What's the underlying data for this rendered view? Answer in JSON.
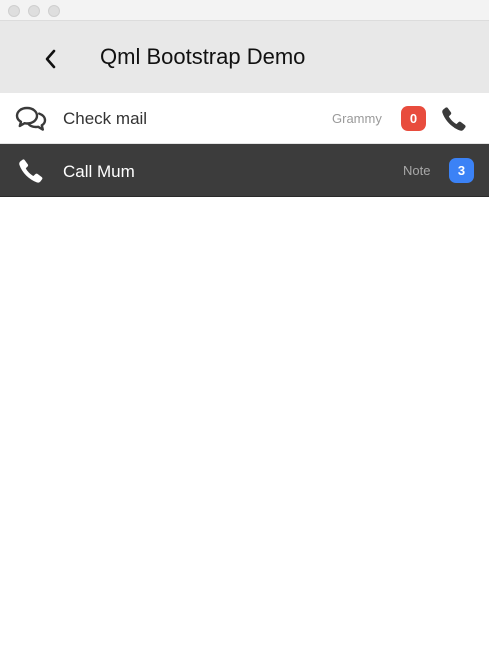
{
  "window": {
    "traffic_lights": [
      "close",
      "minimize",
      "zoom"
    ]
  },
  "navbar": {
    "title": "Qml Bootstrap Demo",
    "back_icon": "chevron-left-icon"
  },
  "list": {
    "items": [
      {
        "label": "Check mail",
        "icon": "comments-icon",
        "detail": "Grammy",
        "badge": "0",
        "badge_color": "#e84c3d",
        "action_icon": "phone-icon",
        "style": "light"
      },
      {
        "label": "Call Mum",
        "icon": "phone-icon",
        "detail": "Note",
        "badge": "3",
        "badge_color": "#3b82f6",
        "style": "dark"
      }
    ]
  },
  "colors": {
    "navbar_bg": "#e8e8e8",
    "dark_row_bg": "#3c3c3c",
    "badge_red": "#e84c3d",
    "badge_blue": "#3b82f6"
  }
}
